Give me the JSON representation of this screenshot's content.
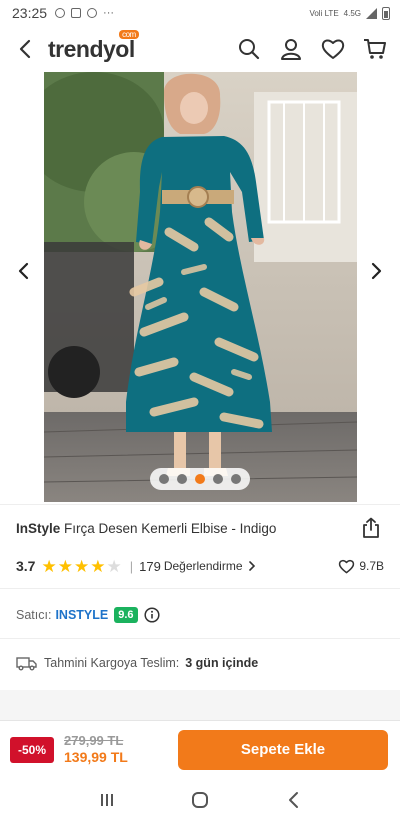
{
  "status_bar": {
    "time": "23:25",
    "dots": "···",
    "network": "Voli LTE",
    "network_speed": "4.5G"
  },
  "header": {
    "logo_text": "trendyol",
    "logo_badge": "com",
    "icons": [
      "back-arrow-icon",
      "search-icon",
      "user-icon",
      "heart-icon",
      "cart-icon"
    ]
  },
  "gallery": {
    "image_count": 5,
    "active_index": 2
  },
  "product": {
    "brand": "InStyle",
    "name": "Fırça Desen Kemerli Elbise - Indigo",
    "rating": "3.7",
    "rating_value": 3.7,
    "stars_filled": 4,
    "stars_total": 5,
    "review_count": "179",
    "review_label": "Değerlendirme",
    "favorites": "9.7B"
  },
  "seller": {
    "label": "Satıcı:",
    "name": "INSTYLE",
    "score": "9.6"
  },
  "shipping": {
    "label": "Tahmini Kargoya Teslim:",
    "value": "3 gün içinde"
  },
  "purchase": {
    "discount": "-50%",
    "old_price": "279,99 TL",
    "new_price": "139,99 TL",
    "button_label": "Sepete Ekle"
  },
  "colors": {
    "brand_orange": "#f27a1a",
    "discount_red": "#d1112b",
    "seller_blue": "#1e73c9",
    "score_green": "#1bb25e",
    "star_yellow": "#ffc000"
  }
}
